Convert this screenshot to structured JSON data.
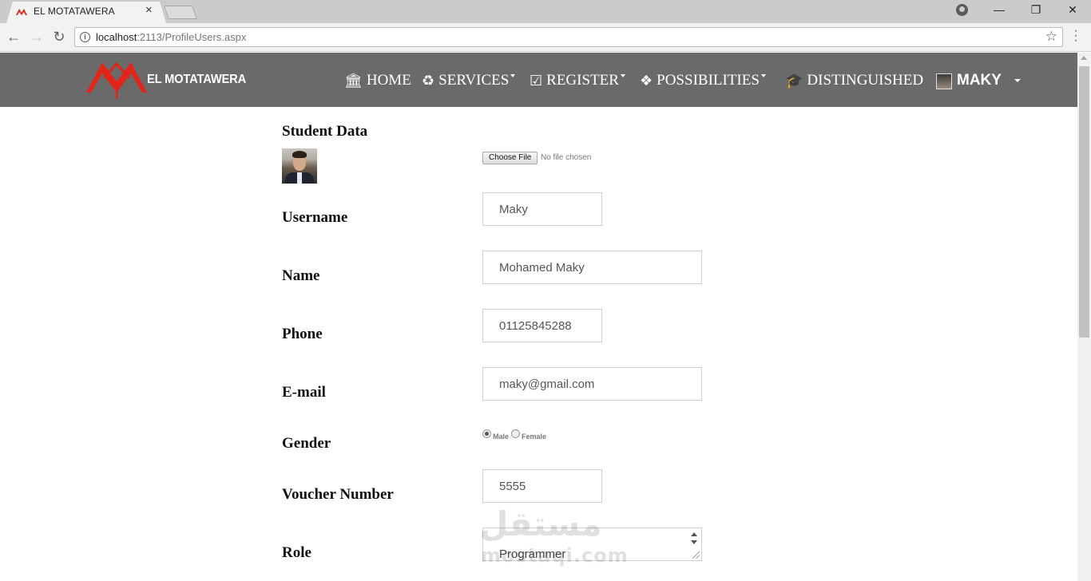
{
  "browser": {
    "tab_title": "EL MOTATAWERA",
    "tab_close": "×",
    "url_host": "localhost",
    "url_rest": ":2113/ProfileUsers.aspx",
    "window_controls": {
      "minimize": "—",
      "restore": "❐",
      "close": "✕"
    },
    "nav": {
      "back": "←",
      "forward": "→",
      "reload": "↻"
    }
  },
  "site": {
    "brand": "EL MOTATAWERA",
    "brand_color": "#e1251b",
    "nav_bg": "#6a6a6a",
    "menu": [
      {
        "label": "HOME",
        "icon": "bank-icon",
        "glyph": "🏛",
        "has_caret": false
      },
      {
        "label": "SERVICES",
        "icon": "recycle-icon",
        "glyph": "♻",
        "has_caret": true
      },
      {
        "label": "REGISTER",
        "icon": "check-square-icon",
        "glyph": "☑",
        "has_caret": true
      },
      {
        "label": "POSSIBILITIES",
        "icon": "cubes-icon",
        "glyph": "❖",
        "has_caret": true
      },
      {
        "label": "DISTINGUISHED",
        "icon": "graduation-cap-icon",
        "glyph": "🎓",
        "has_caret": false
      }
    ],
    "user": {
      "name": "MAKY"
    }
  },
  "form": {
    "title": "Student Data",
    "file": {
      "button": "Choose File",
      "status": "No file chosen"
    },
    "fields": {
      "username": {
        "label": "Username",
        "value": "Maky"
      },
      "name": {
        "label": "Name",
        "value": "Mohamed Maky"
      },
      "phone": {
        "label": "Phone",
        "value": "01125845288"
      },
      "email": {
        "label": "E-mail",
        "value": "maky@gmail.com"
      },
      "gender": {
        "label": "Gender",
        "options": [
          "Male",
          "Female"
        ],
        "selected": "Male"
      },
      "voucher": {
        "label": "Voucher Number",
        "value": "5555"
      },
      "role": {
        "label": "Role",
        "value": "Programmer"
      }
    }
  },
  "watermark": {
    "arabic": "مستقل",
    "latin": "mostaqi.com"
  }
}
